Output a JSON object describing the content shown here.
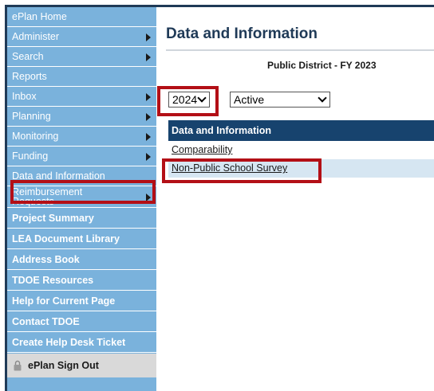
{
  "sidebar": {
    "items": [
      {
        "label": "ePlan Home",
        "arrow": false
      },
      {
        "label": "Administer",
        "arrow": true
      },
      {
        "label": "Search",
        "arrow": true
      },
      {
        "label": "Reports",
        "arrow": false
      },
      {
        "label": "Inbox",
        "arrow": true
      },
      {
        "label": "Planning",
        "arrow": true
      },
      {
        "label": "Monitoring",
        "arrow": true
      },
      {
        "label": "Funding",
        "arrow": true
      },
      {
        "label": "Data and Information",
        "arrow": false
      },
      {
        "label_line1": "Reimbursement",
        "label_line2": "Requests",
        "arrow": true
      },
      {
        "label": "Project Summary",
        "arrow": false
      },
      {
        "label": "LEA Document Library",
        "arrow": false
      },
      {
        "label": "Address Book",
        "arrow": false
      },
      {
        "label": "TDOE Resources",
        "arrow": false
      },
      {
        "label": "Help for Current Page",
        "arrow": false
      },
      {
        "label": "Contact TDOE",
        "arrow": false
      },
      {
        "label": "Create Help Desk Ticket",
        "arrow": false
      }
    ],
    "signout": {
      "label": "ePlan Sign Out",
      "icon": "lock-icon"
    }
  },
  "main": {
    "title": "Data and Information",
    "district": "Public District - FY 2023",
    "year_select": {
      "value": "2024",
      "icon": "chevron-down-icon"
    },
    "status_select": {
      "value": "Active",
      "icon": "chevron-down-icon"
    },
    "table": {
      "header": "Data and Information",
      "rows": [
        {
          "label": "Comparability"
        },
        {
          "label": "Non-Public School Survey"
        }
      ]
    }
  },
  "colors": {
    "sidebar_bg": "#7ab2dc",
    "header_bg": "#17436e",
    "title_color": "#1f3a57",
    "alt_row": "#d6e6f2",
    "highlight": "#b30f16",
    "signout_bg": "#d9d9d9"
  }
}
